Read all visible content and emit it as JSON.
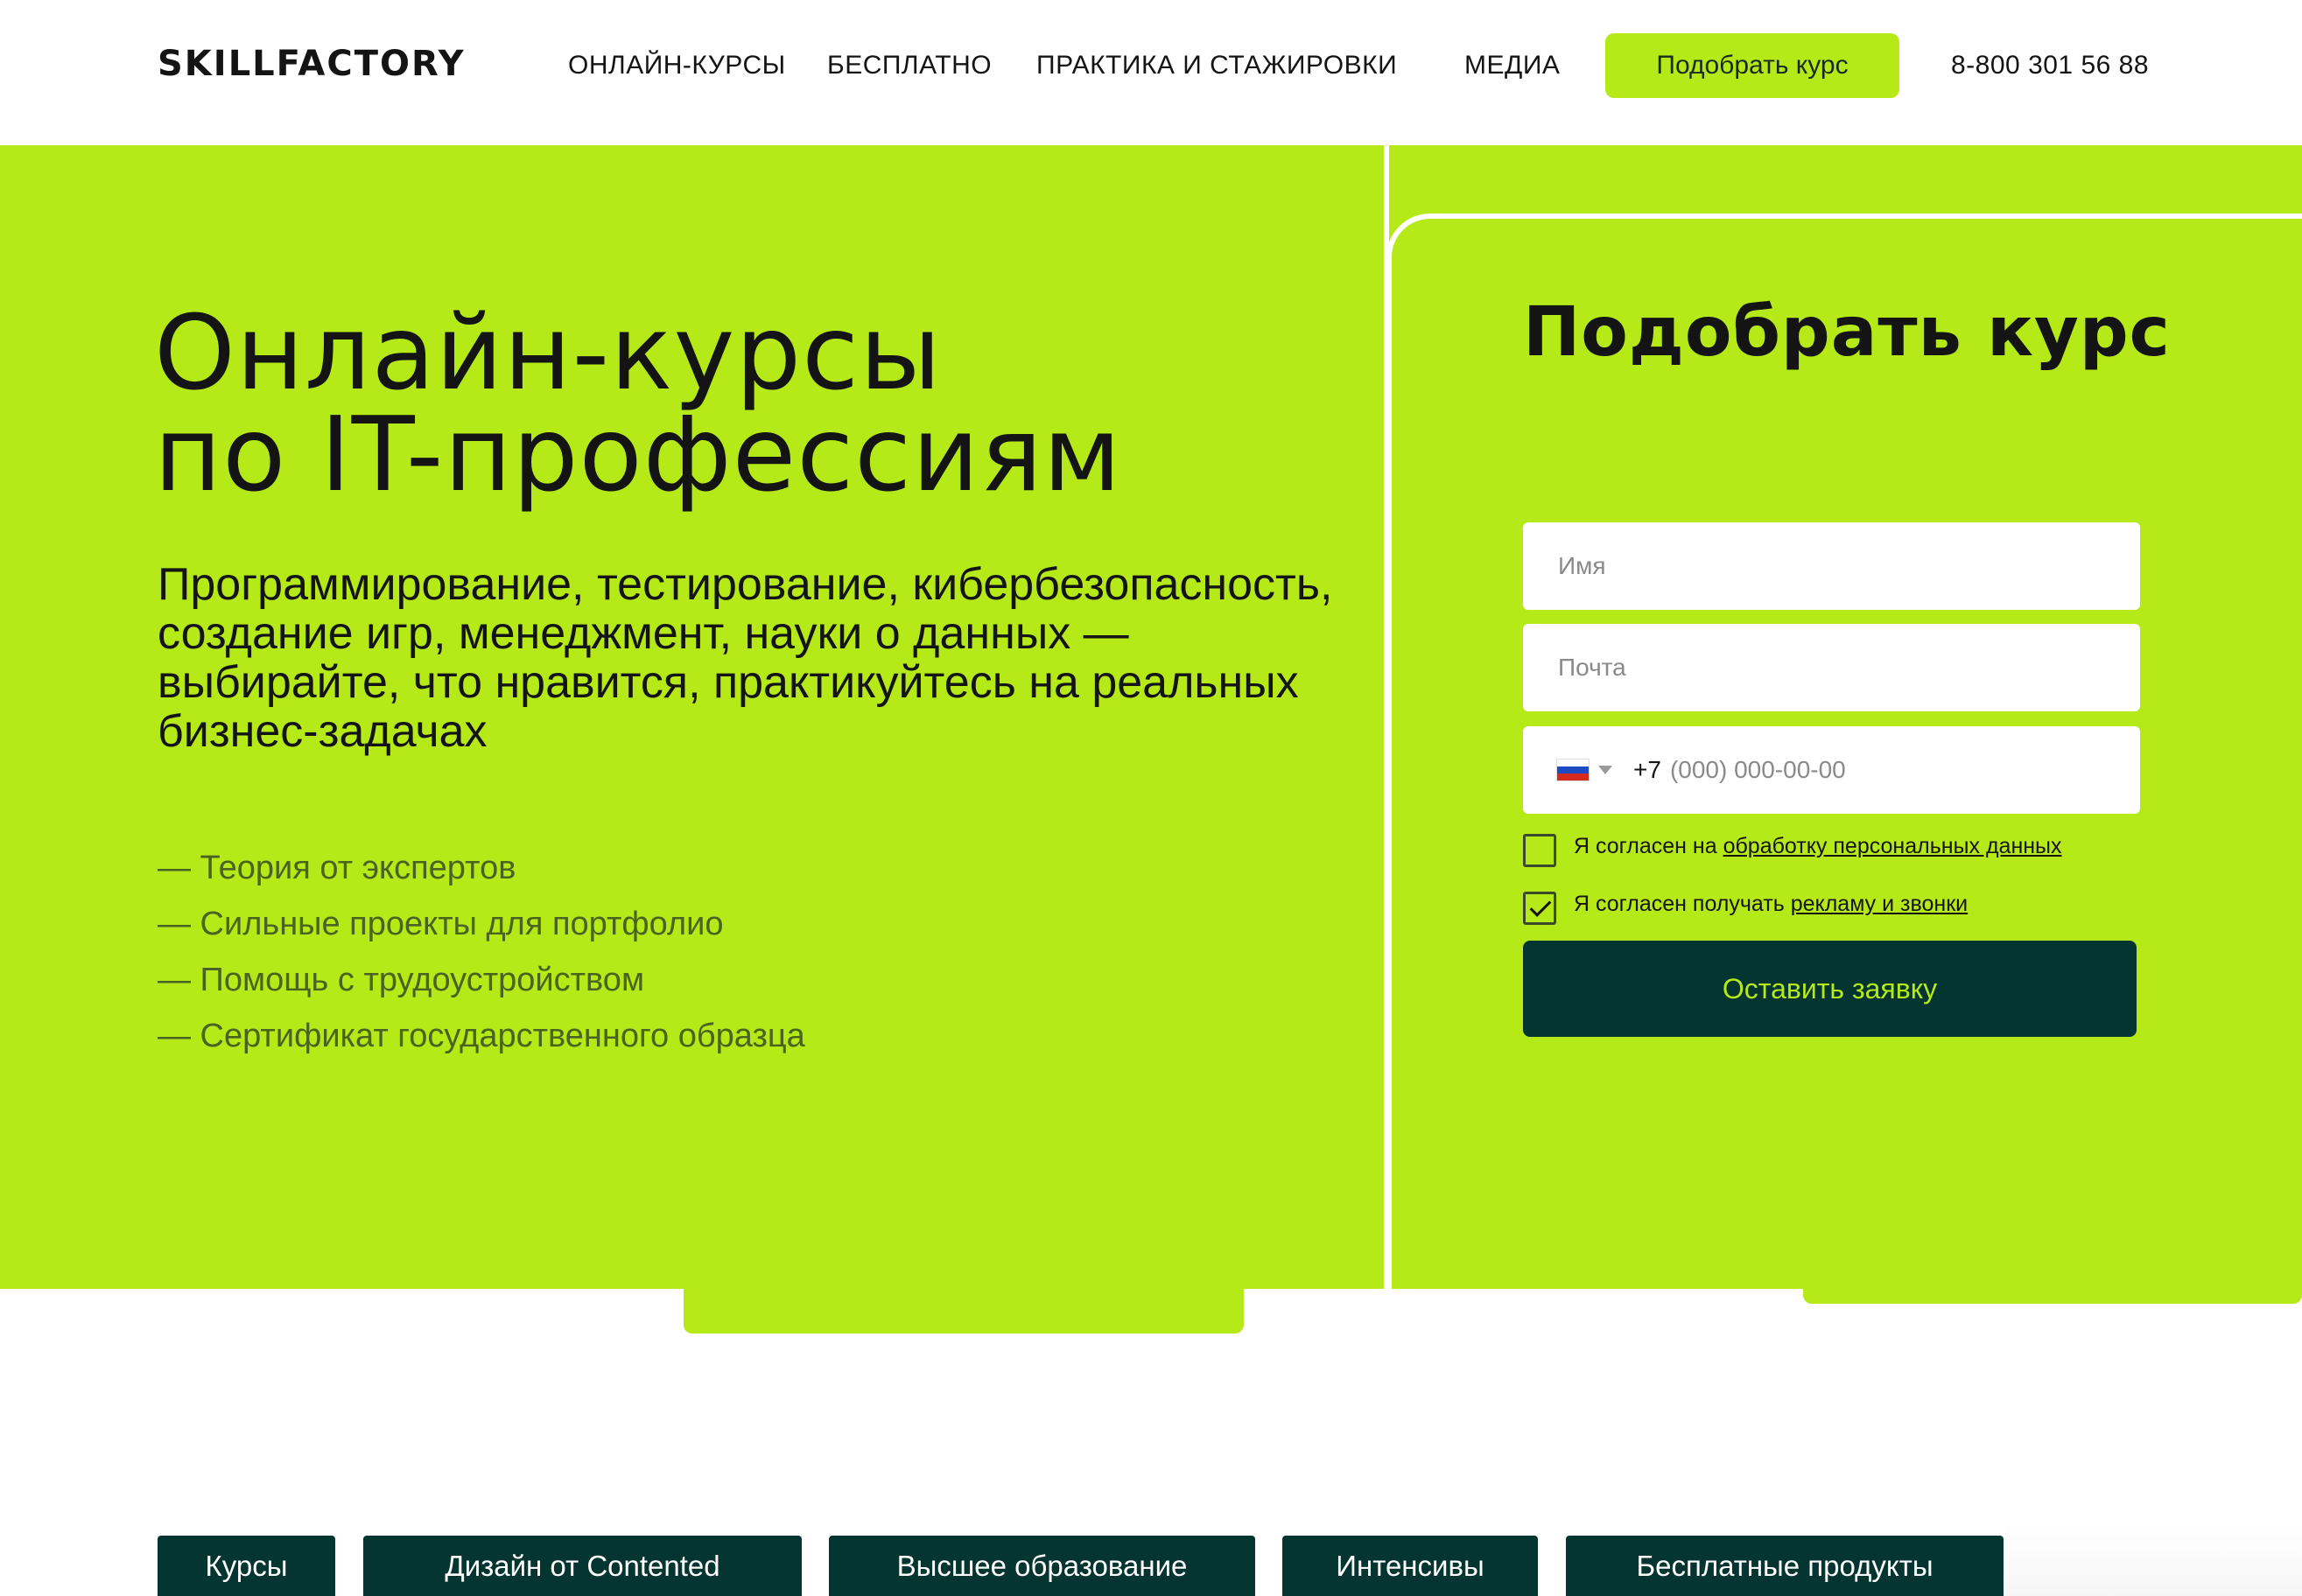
{
  "header": {
    "logo": "SKILLFACTORY",
    "nav": [
      {
        "label": "ОНЛАЙН-КУРСЫ"
      },
      {
        "label": "БЕСПЛАТНО"
      },
      {
        "label": "ПРАКТИКА И СТАЖИРОВКИ"
      },
      {
        "label": "МЕДИА"
      }
    ],
    "cta_label": "Подобрать курс",
    "phone": "8-800 301 56 88"
  },
  "hero": {
    "title_line1": "Онлайн-курсы",
    "title_line2": "по IT-профессиям",
    "subtitle": "Программирование, тестирование, кибербезопасность, создание игр, менеджмент, науки о данных — выбирайте, что нравится, практикуйтесь на реальных бизнес-задачах",
    "features": [
      "— Теория от экспертов",
      "— Сильные проекты для портфолио",
      "— Помощь с трудоустройством",
      "— Сертификат государственного образца"
    ]
  },
  "form": {
    "title": "Подобрать курс",
    "name_placeholder": "Имя",
    "email_placeholder": "Почта",
    "country_icon": "russia-flag-icon",
    "phone_code": "+7",
    "phone_placeholder": "(000) 000-00-00",
    "consent_personal": {
      "checked": false,
      "text": "Я согласен на ",
      "link": "обработку персональных данных"
    },
    "consent_ads": {
      "checked": true,
      "text": "Я согласен получать ",
      "link": "рекламу и звонки"
    },
    "submit_label": "Оставить заявку"
  },
  "tabs": [
    {
      "label": "Курсы"
    },
    {
      "label": "Дизайн от Contented"
    },
    {
      "label": "Высшее образование"
    },
    {
      "label": "Интенсивы"
    },
    {
      "label": "Бесплатные продукты"
    }
  ],
  "colors": {
    "accent": "#b5e917",
    "dark": "#053531",
    "text": "#141414",
    "feature_text": "#4a6320"
  }
}
